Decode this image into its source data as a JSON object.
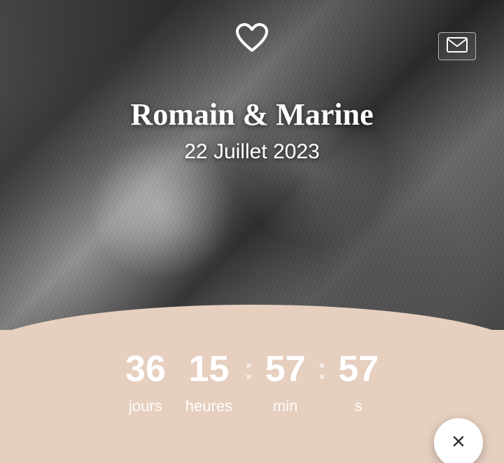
{
  "header": {
    "title": "Romain & Marine",
    "date": "22 Juillet 2023"
  },
  "countdown": {
    "days": {
      "value": "36",
      "label": "jours"
    },
    "hours": {
      "value": "15",
      "label": "heures"
    },
    "mins": {
      "value": "57",
      "label": "min"
    },
    "secs": {
      "value": "57",
      "label": "s"
    }
  },
  "colors": {
    "band": "#e6cfbf"
  }
}
